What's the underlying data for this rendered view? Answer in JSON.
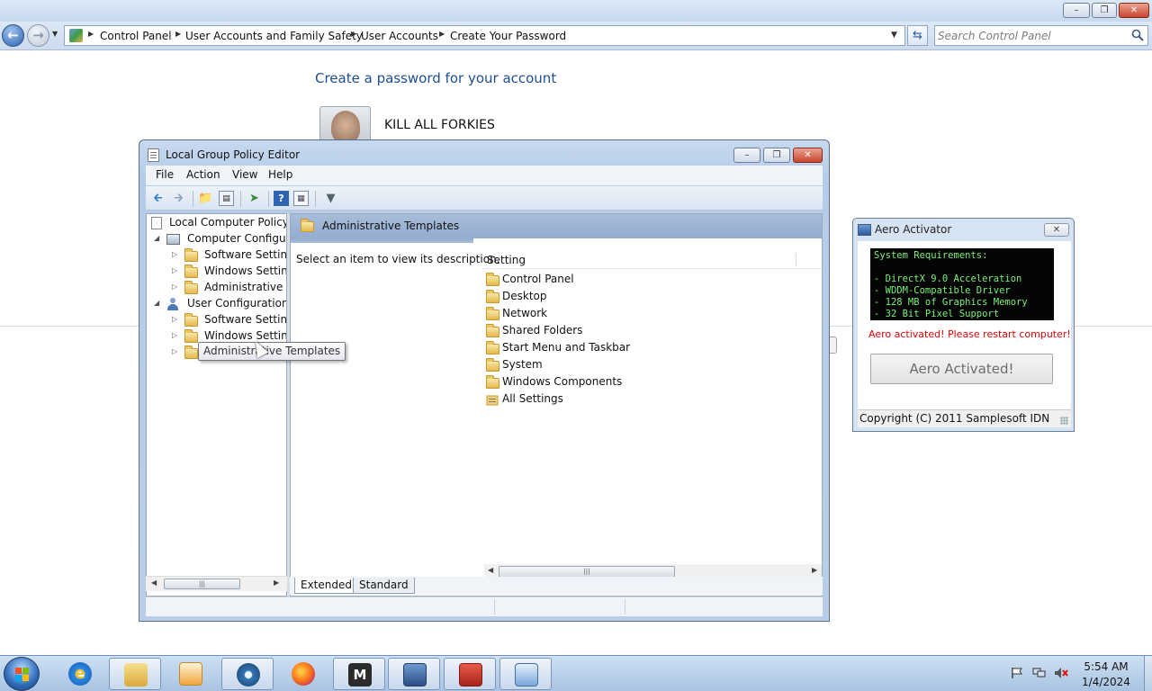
{
  "control_panel": {
    "breadcrumbs": [
      "Control Panel",
      "User Accounts and Family Safety",
      "User Accounts",
      "Create Your Password"
    ],
    "search_placeholder": "Search Control Panel",
    "heading": "Create a password for your account",
    "account_name": "KILL ALL FORKIES"
  },
  "gpedit": {
    "title": "Local Group Policy Editor",
    "menu": [
      "File",
      "Action",
      "View",
      "Help"
    ],
    "toolbar_icons": [
      "back-arrow-icon",
      "forward-arrow-icon",
      "up-folder-icon",
      "show-hide-tree-icon",
      "export-list-icon",
      "help-icon",
      "properties-icon",
      "filter-icon"
    ],
    "tree": {
      "root": "Local Computer Policy",
      "computer_config": "Computer Configura",
      "computer_children": [
        "Software Settings",
        "Windows Setting",
        "Administrative Te"
      ],
      "user_config": "User Configuration",
      "user_children": [
        "Software Settings",
        "Windows Setting",
        "Administrative Templates"
      ]
    },
    "content_header": "Administrative Templates",
    "description": "Select an item to view its description.",
    "column_header": "Setting",
    "settings": [
      "Control Panel",
      "Desktop",
      "Network",
      "Shared Folders",
      "Start Menu and Taskbar",
      "System",
      "Windows Components",
      "All Settings"
    ],
    "tabs": [
      "Extended",
      "Standard"
    ],
    "tooltip": "Administrative Templates"
  },
  "aero": {
    "title": "Aero Activator",
    "console_lines": [
      "System Requirements:",
      "",
      "- DirectX 9.0 Acceleration",
      "- WDDM-Compatible Driver",
      "- 128 MB of Graphics Memory",
      "- 32 Bit Pixel Support"
    ],
    "status": "Aero activated! Please restart computer!",
    "button_label": "Aero Activated!",
    "copyright": "Copyright (C) 2011 Samplesoft IDN"
  },
  "taskbar": {
    "apps": [
      "Windows Explorer",
      "Internet Explorer",
      "Media",
      "Browser",
      "Firefox",
      "M",
      "Console",
      "Toolbox",
      "Network"
    ],
    "time": "5:54 AM",
    "date": "1/4/2024"
  },
  "colors": {
    "heading_blue": "#1d4f91",
    "status_red": "#e10000",
    "console_green": "#7cf07a"
  }
}
